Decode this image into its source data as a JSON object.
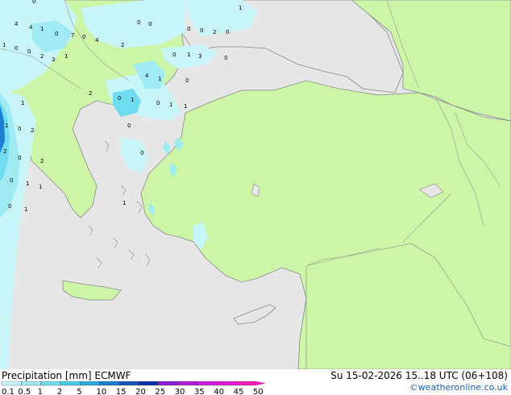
{
  "footer": {
    "title": "Precipitation [mm]  ECMWF",
    "datetime": "Su 15-02-2026 15..18 UTC (06+108)",
    "credit": "©weatheronline.co.uk"
  },
  "legend": {
    "ticks": [
      "0.1",
      "0.5",
      "1",
      "2",
      "5",
      "10",
      "15",
      "20",
      "25",
      "30",
      "35",
      "40",
      "45",
      "50"
    ],
    "colors": [
      "#c8f5f7",
      "#a0eaf4",
      "#70dcf0",
      "#4cc8ec",
      "#2ca8e0",
      "#1c7ed0",
      "#1256bc",
      "#0a32a8",
      "#8a1cd8",
      "#b01cd8",
      "#cc1ce0",
      "#e01cd0",
      "#f01cb8"
    ]
  },
  "map": {
    "colors": {
      "sea": "#e6e6e6",
      "land_rain_free": "#ccf5a8",
      "land_outside": "#e6e6e6",
      "border": "#999999",
      "coast": "#888888"
    },
    "precip_labels": [
      "0",
      "4",
      "4",
      "1",
      "0",
      "7",
      "0",
      "4",
      "2",
      "0",
      "0",
      "0",
      "0",
      "2",
      "0",
      "1",
      "1",
      "0",
      "0",
      "2",
      "3",
      "1",
      "0",
      "1",
      "3",
      "0",
      "4",
      "1",
      "0",
      "2",
      "0",
      "1",
      "0",
      "1",
      "1",
      "0",
      "1",
      "1",
      "0",
      "2",
      "2",
      "0",
      "2",
      "0",
      "1",
      "1",
      "0",
      "1",
      "1",
      "0"
    ]
  }
}
